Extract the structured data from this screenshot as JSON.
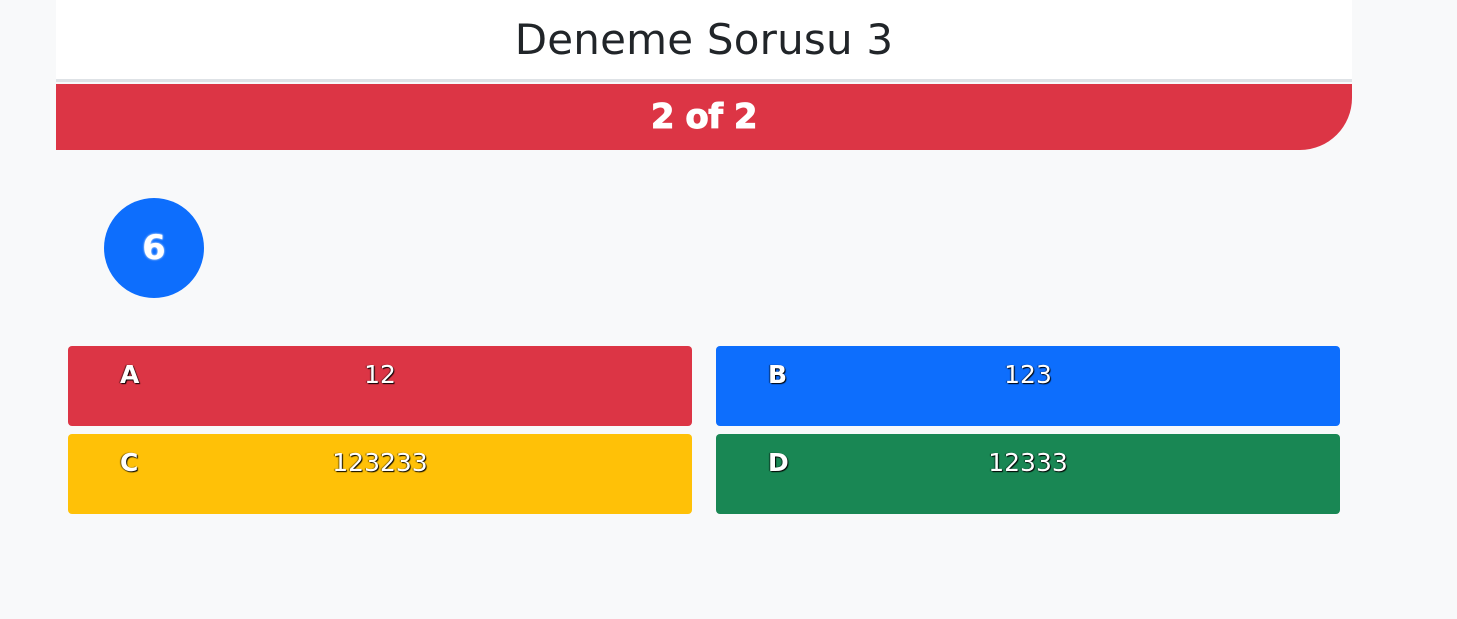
{
  "question": {
    "title": "Deneme Sorusu 3"
  },
  "progress": {
    "text": "2 of 2",
    "current": 2,
    "total": 2
  },
  "timer": {
    "value": "6"
  },
  "answers": [
    {
      "letter": "A",
      "value": "12",
      "color": "#dc3545"
    },
    {
      "letter": "B",
      "value": "123",
      "color": "#0d6efd"
    },
    {
      "letter": "C",
      "value": "123233",
      "color": "#ffc107"
    },
    {
      "letter": "D",
      "value": "12333",
      "color": "#198754"
    }
  ],
  "colors": {
    "background": "#f8f9fa",
    "header_background": "#ffffff",
    "banner": "#dc3545",
    "timer": "#0d6efd"
  }
}
